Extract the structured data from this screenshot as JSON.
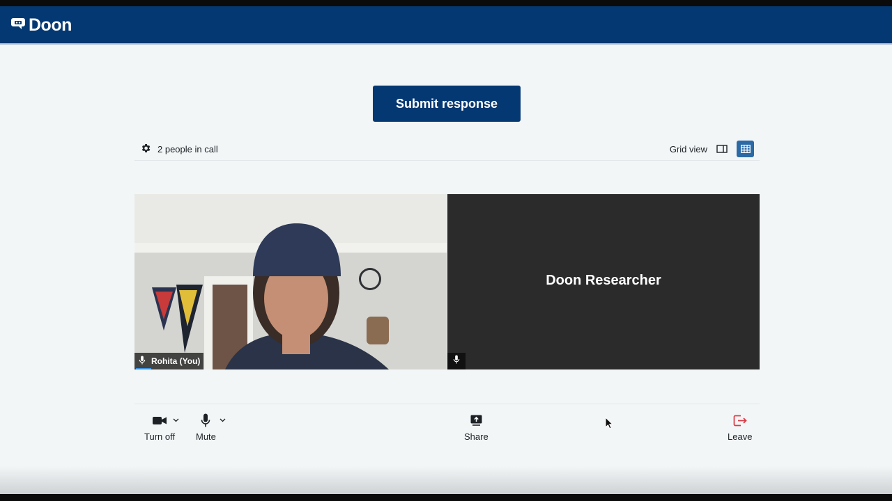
{
  "app": {
    "name": "Doon"
  },
  "submit": {
    "label": "Submit response"
  },
  "call": {
    "people_label": "2 people in call",
    "view_label": "Grid view",
    "view_mode": "grid"
  },
  "participants": [
    {
      "name": "Rohita (You)",
      "camera": "on"
    },
    {
      "name": "Doon Researcher",
      "camera": "off"
    }
  ],
  "controls": {
    "camera_label": "Turn off",
    "mic_label": "Mute",
    "share_label": "Share",
    "leave_label": "Leave"
  },
  "colors": {
    "brand": "#043872",
    "accent": "#2c6aa5",
    "leave": "#d93b45",
    "tile_dark": "#2b2b2b",
    "background": "#f3f6f7"
  },
  "icons": [
    "chat-bubble-logo-icon",
    "gear-icon",
    "sidebar-view-icon",
    "grid-view-icon",
    "microphone-icon",
    "video-camera-icon",
    "chevron-down-icon",
    "share-screen-icon",
    "leave-icon",
    "mouse-pointer-icon"
  ]
}
